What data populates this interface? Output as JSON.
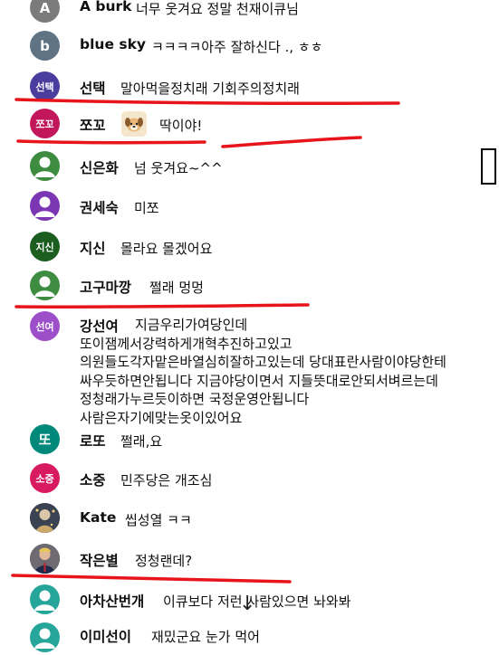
{
  "comments": [
    {
      "avatar_text": "A",
      "avatar_color": "#7b7b7b",
      "name": "A burk",
      "text": "너무 웃겨요 정말 천재이큐님"
    },
    {
      "avatar_text": "b",
      "avatar_color": "#5f7385",
      "name": "blue sky",
      "text": "ㅋㅋㅋㅋ아주 잘하신다 ., ㅎㅎ"
    },
    {
      "avatar_text": "선택",
      "avatar_color": "#4a3d9e",
      "name": "선택",
      "text": "말아먹을정치래 기회주의정치래"
    },
    {
      "avatar_text": "쪼꼬",
      "avatar_color": "#c2185b",
      "name": "쪼꼬",
      "text": "딱이야!",
      "emoji_icon": "dog-emoji-icon"
    },
    {
      "avatar_text": "",
      "avatar_color": "#3d8c40",
      "name": "신은화",
      "text": "넘 웃겨요~^^",
      "avatar_icon": "default-user-icon"
    },
    {
      "avatar_text": "",
      "avatar_color": "#7b36b3",
      "name": "권세숙",
      "text": "미쪼",
      "avatar_icon": "default-user-icon"
    },
    {
      "avatar_text": "지신",
      "avatar_color": "#1b5e20",
      "name": "지신",
      "text": "몰라요 몰겠어요"
    },
    {
      "avatar_text": "",
      "avatar_color": "#3d8c40",
      "name": "고구마깡",
      "text": "쩔래 멍멍",
      "avatar_icon": "default-user-icon"
    },
    {
      "avatar_text": "선여",
      "avatar_color": "#9c4fc9",
      "name": "강선여",
      "text": "지금우리가여당인데 또이잼께서강력하게개혁추진하고있고 의원들도각자맡은바열심히잘하고있는데 당대표란사람이야당한테 싸우듯하면안됩니다 지금야당이면서 지들뜻대로안되서벼르는데 정청래가누르듯이하면 국정운영안됩니다 사람은자기에맞는옷이있어요"
    },
    {
      "avatar_text": "또",
      "avatar_color": "#00897b",
      "name": "로또",
      "text": "쩔래,요"
    },
    {
      "avatar_text": "소중",
      "avatar_color": "#d81b60",
      "name": "소중",
      "text": "민주당은 개조심"
    },
    {
      "avatar_text": "",
      "avatar_color": "#4e5a6e",
      "name": "Kate",
      "text": "씹성열 ㅋㅋ",
      "avatar_icon": "photo-avatar-icon"
    },
    {
      "avatar_text": "",
      "avatar_color": "#5b4a52",
      "name": "작은별",
      "text": "정청랜데?",
      "avatar_icon": "photo-avatar-icon"
    },
    {
      "avatar_text": "",
      "avatar_color": "#26a69a",
      "name": "아차산번개",
      "text": "이큐보다 저런 사람있으면 놔와봐",
      "avatar_icon": "default-user-icon"
    },
    {
      "avatar_text": "",
      "avatar_color": "#26a69a",
      "name": "이미선이",
      "text": "재밌군요 눈가 먹어",
      "avatar_icon": "default-user-icon"
    }
  ],
  "annotations": {
    "underline_color": "#e8141b",
    "side_box": "rectangle-outline"
  },
  "scroll_hint": {
    "icon": "down-arrow-icon",
    "glyph": "↓"
  }
}
